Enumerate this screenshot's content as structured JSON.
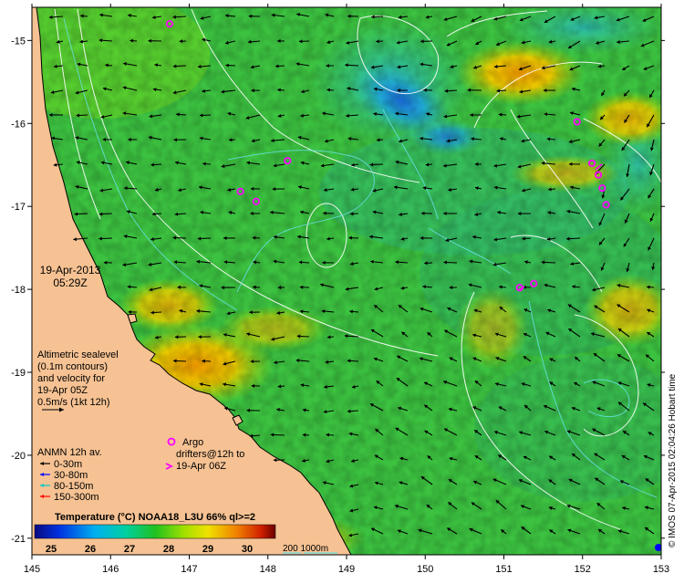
{
  "map": {
    "timestamp": {
      "date": "19-Apr-2013",
      "time": "05:29Z"
    },
    "altimetry_note": [
      "Altimetric sealevel",
      "(0.1m contours)",
      "and velocity for",
      "19-Apr 05Z",
      "0.5m/s (1kt 12h)"
    ],
    "anmn_legend": {
      "title": "ANMN 12h av.",
      "items": [
        {
          "label": "0-30m",
          "color": "#000000"
        },
        {
          "label": "30-80m",
          "color": "#0000ff"
        },
        {
          "label": "80-150m",
          "color": "#00c8c8"
        },
        {
          "label": "150-300m",
          "color": "#ff0000"
        }
      ]
    },
    "argo_label": "Argo",
    "drifters_label": [
      "drifters@12h to",
      "19-Apr 06Z"
    ],
    "colorbar": {
      "title": "Temperature (°C) NOAA18_L3U 66% ql>=2",
      "ticks": [
        "25",
        "26",
        "27",
        "28",
        "29",
        "30"
      ]
    },
    "depth_legend": "200  1000m",
    "credit": "© IMOS 07-Apr-2015 02:04:26 Hobart time",
    "x_ticks": [
      "145",
      "146",
      "147",
      "148",
      "149",
      "150",
      "151",
      "152",
      "153"
    ],
    "y_ticks": [
      "-15",
      "-16",
      "-17",
      "-18",
      "-19",
      "-20",
      "-21"
    ],
    "x_range": [
      145,
      153
    ],
    "y_range": [
      -21.2,
      -14.6
    ],
    "colors": {
      "land": "#f6c293",
      "coast": "#000000",
      "contour": "#ffffff",
      "bathy": "#66e0e0",
      "argo": "#ff00ff"
    },
    "argo_floats": [
      {
        "lon": 146.75,
        "lat": -14.8
      },
      {
        "lon": 147.65,
        "lat": -16.82
      },
      {
        "lon": 147.85,
        "lat": -16.94
      },
      {
        "lon": 148.25,
        "lat": -16.45
      },
      {
        "lon": 151.93,
        "lat": -15.98
      },
      {
        "lon": 152.12,
        "lat": -16.48
      },
      {
        "lon": 152.2,
        "lat": -16.62
      },
      {
        "lon": 152.25,
        "lat": -16.78
      },
      {
        "lon": 152.3,
        "lat": -16.98
      },
      {
        "lon": 151.2,
        "lat": -17.98
      },
      {
        "lon": 151.38,
        "lat": -17.93
      }
    ]
  }
}
